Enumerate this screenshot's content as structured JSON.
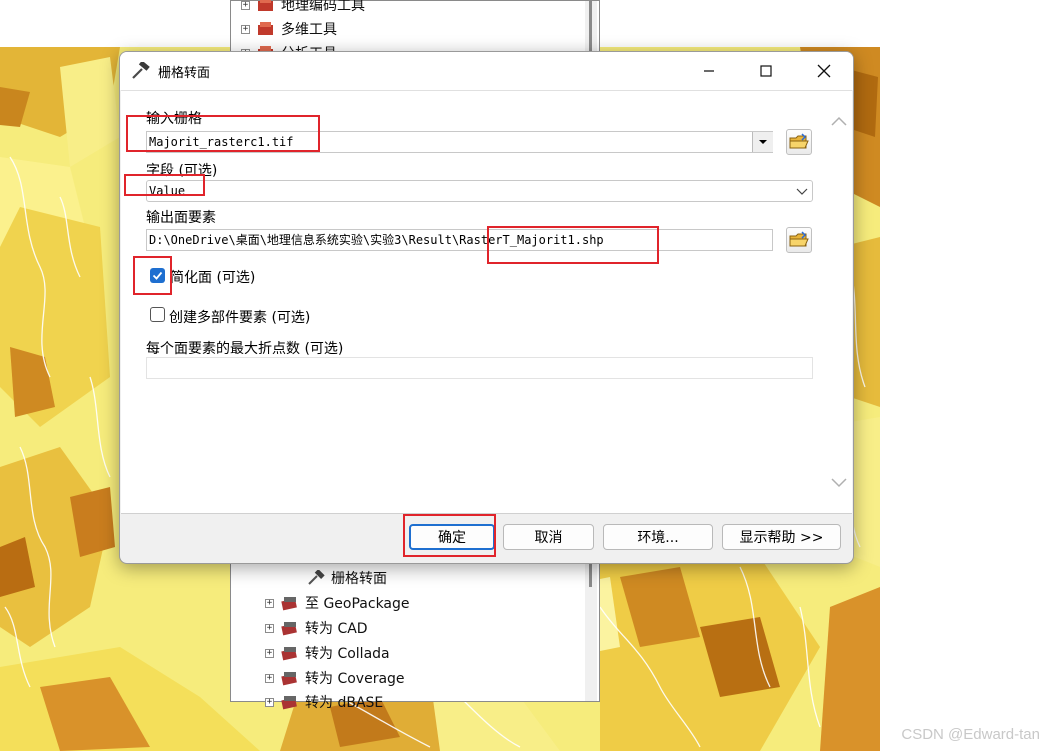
{
  "tree_top": {
    "items": [
      {
        "label": "地理编码工具",
        "expander": "+"
      },
      {
        "label": "多维工具",
        "expander": "+"
      },
      {
        "label": "分析工具",
        "expander": "+"
      }
    ]
  },
  "tree_bottom": {
    "items": [
      {
        "label": "栅格转面",
        "expander": ""
      },
      {
        "label": "至 GeoPackage",
        "expander": "+"
      },
      {
        "label": "转为 CAD",
        "expander": "+"
      },
      {
        "label": "转为 Collada",
        "expander": "+"
      },
      {
        "label": "转为 Coverage",
        "expander": "+"
      },
      {
        "label": "转为 dBASE",
        "expander": "+"
      }
    ]
  },
  "dialog": {
    "title": "栅格转面",
    "input_raster": {
      "label": "输入栅格",
      "value": "Majorit_rasterc1.tif"
    },
    "field": {
      "label": "字段 (可选)",
      "value": "Value"
    },
    "output": {
      "label": "输出面要素",
      "value": "D:\\OneDrive\\桌面\\地理信息系统实验\\实验3\\Result\\RasterT_Majorit1.shp"
    },
    "simplify": {
      "label": "简化面 (可选)",
      "checked": true
    },
    "multipart": {
      "label": "创建多部件要素 (可选)",
      "checked": false
    },
    "max_vertices": {
      "label": "每个面要素的最大折点数 (可选)",
      "value": ""
    },
    "buttons": {
      "ok": "确定",
      "cancel": "取消",
      "env": "环境...",
      "help": "显示帮助 >>"
    }
  },
  "watermark": "CSDN @Edward-tan",
  "colors": {
    "accent": "#1e6fd0",
    "highlight": "#e0242b"
  }
}
